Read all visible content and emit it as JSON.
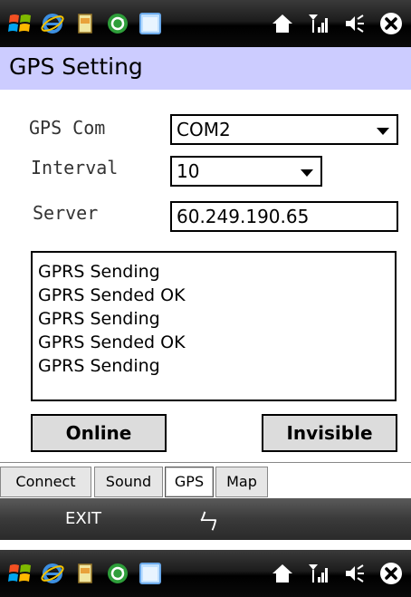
{
  "status_bar": {
    "icons": [
      "windows-start-icon",
      "internet-explorer-icon",
      "file-icon",
      "sync-icon",
      "window-icon",
      "home-icon",
      "signal-icon",
      "volume-icon",
      "close-icon"
    ]
  },
  "title": "GPS Setting",
  "form": {
    "gps_com_label": "GPS Com",
    "gps_com_value": "COM2",
    "interval_label": "Interval",
    "interval_value": "10",
    "server_label": "Server",
    "server_value": "60.249.190.65"
  },
  "log": [
    "GPRS Sending",
    "GPRS Sended OK",
    "GPRS Sending",
    "GPRS Sended OK",
    "GPRS Sending"
  ],
  "buttons": {
    "online": "Online",
    "invisible": "Invisible"
  },
  "tabs": [
    {
      "label": "Connect",
      "active": false
    },
    {
      "label": "Sound",
      "active": false
    },
    {
      "label": "GPS",
      "active": true
    },
    {
      "label": "Map",
      "active": false
    }
  ],
  "softkeys": {
    "left": "EXIT",
    "middle": "ㄣ"
  },
  "colors": {
    "title_bar": "#ccccff",
    "status_bar": "#000000",
    "softkey_bar": "#3a3a3a"
  }
}
